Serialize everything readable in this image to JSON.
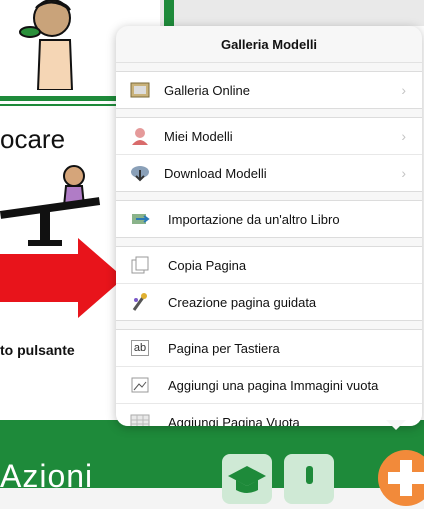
{
  "background": {
    "word_partial": "ocare",
    "pulsante_text": "to pulsante",
    "bottom_word": "Azioni"
  },
  "popover": {
    "title": "Galleria Modelli",
    "sections": [
      {
        "items": [
          {
            "label": "Galleria Online",
            "icon": "gallery-icon",
            "chevron": "›"
          }
        ]
      },
      {
        "items": [
          {
            "label": "Miei Modelli",
            "icon": "user-icon",
            "chevron": "›"
          },
          {
            "label": "Download Modelli",
            "icon": "cloud-download-icon",
            "chevron": "›"
          }
        ]
      },
      {
        "items": [
          {
            "label": "Importazione da un'altro Libro",
            "icon": "import-icon"
          }
        ]
      },
      {
        "items": [
          {
            "label": "Copia Pagina",
            "icon": "copy-page-icon"
          },
          {
            "label": "Creazione pagina guidata",
            "icon": "wizard-icon"
          }
        ]
      },
      {
        "items": [
          {
            "label": "Pagina per Tastiera",
            "icon": "keyboard-page-icon",
            "icon_text": "ab"
          },
          {
            "label": "Aggiungi una pagina Immagini vuota",
            "icon": "image-page-icon"
          },
          {
            "label": "Aggiungi Pagina Vuota",
            "icon": "blank-page-icon"
          }
        ]
      }
    ]
  },
  "colors": {
    "accent_green": "#1e8a3a",
    "arrow_red": "#e8141b",
    "plus_orange": "#f28a3a"
  }
}
